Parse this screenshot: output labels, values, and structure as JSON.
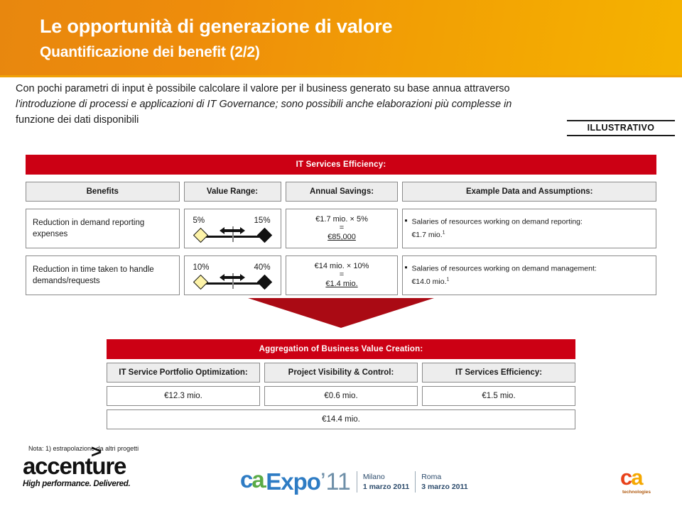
{
  "header": {
    "title": "Le opportunità di generazione di valore",
    "subtitle": "Quantificazione dei benefit (2/2)",
    "gradient_from": "#e8870e",
    "gradient_to": "#f5b300"
  },
  "intro": {
    "line1": "Con pochi parametri di input è possibile calcolare  il valore per il business generato su base annua attraverso",
    "line2": "l'introduzione di processi e applicazioni di IT Governance; sono possibili anche elaborazioni più complesse in",
    "line3": "funzione dei dati disponibili"
  },
  "stamp": {
    "label": "ILLUSTRATIVO"
  },
  "matrix": {
    "section_title": "IT Services Efficiency:",
    "section_color": "#cc0014",
    "columns": [
      "Benefits",
      "Value Range:",
      "Annual Savings:",
      "Example Data and Assumptions:"
    ],
    "rows": [
      {
        "benefit": "Reduction in demand reporting expenses",
        "range_low": "5%",
        "range_high": "15%",
        "savings_formula": "€1.7 mio. × 5%",
        "savings_equals": "=",
        "savings_total": "€85,000",
        "assumption": "Salaries of resources working on demand reporting:",
        "assumption_value": "€1.7 mio.",
        "assumption_note": "1"
      },
      {
        "benefit": "Reduction in time taken to handle demands/requests",
        "range_low": "10%",
        "range_high": "40%",
        "savings_formula": "€14 mio. × 10%",
        "savings_equals": "=",
        "savings_total": "€1.4 mio.",
        "assumption": "Salaries of resources working on demand management:",
        "assumption_value": "€14.0 mio.",
        "assumption_note": "1"
      }
    ]
  },
  "aggregation": {
    "title": "Aggregation of Business Value Creation:",
    "categories": [
      "IT Service Portfolio Optimization:",
      "Project Visibility & Control:",
      "IT Services Efficiency:"
    ],
    "values": [
      "€12.3 mio.",
      "€0.6 mio.",
      "€1.5 mio."
    ],
    "total": "€14.4 mio."
  },
  "footer": {
    "note": "Nota: 1) estrapolazione da altri progetti",
    "accenture_wordmark": "accenture",
    "accenture_tagline": "High performance. Delivered.",
    "expo_ca": "ca",
    "expo_dot": ".",
    "expo_word": "Expo",
    "expo_year": "’11",
    "city1_name": "Milano",
    "city1_date": "1 marzo 2011",
    "city2_name": "Roma",
    "city2_date": "3 marzo 2011",
    "ca_tech_mark": "ca",
    "ca_tech_sub": "technologies"
  }
}
